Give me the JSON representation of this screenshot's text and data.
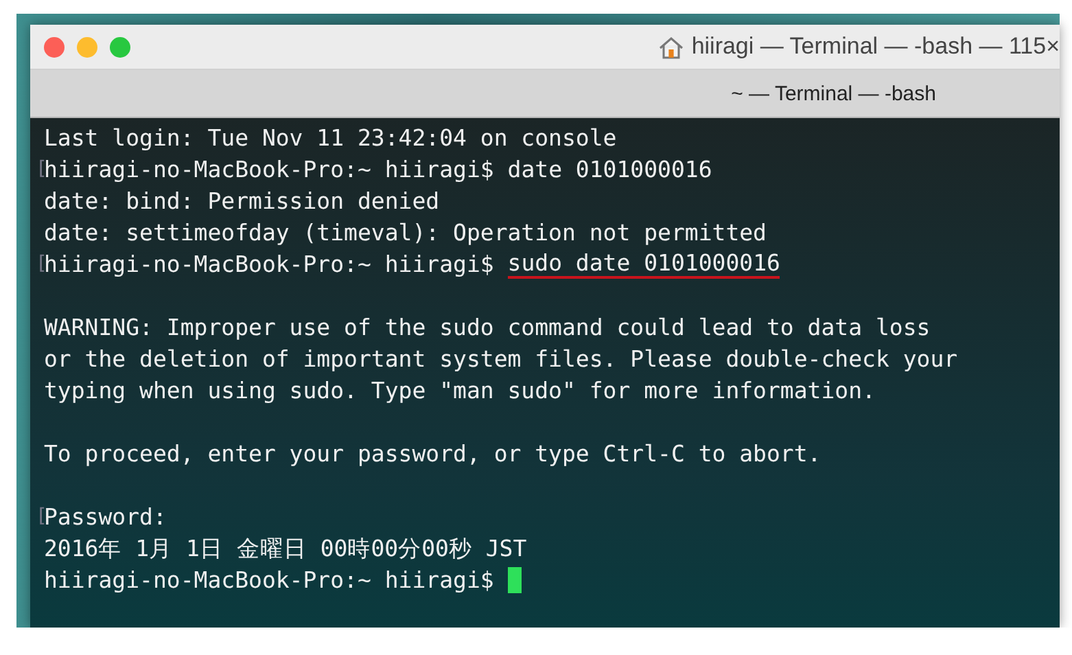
{
  "window": {
    "title": "hiiragi — Terminal — -bash — 115×",
    "tab": "~ — Terminal — -bash"
  },
  "lines": [
    {
      "kind": "output",
      "text": "Last login: Tue Nov 11 23:42:04 on console"
    },
    {
      "kind": "prompt",
      "marker": "[",
      "prompt": "hiiragi-no-MacBook-Pro:~ hiiragi$",
      "command": "date 0101000016",
      "underlined": false
    },
    {
      "kind": "output",
      "text": "date: bind: Permission denied"
    },
    {
      "kind": "output",
      "text": "date: settimeofday (timeval): Operation not permitted"
    },
    {
      "kind": "prompt",
      "marker": "[",
      "prompt": "hiiragi-no-MacBook-Pro:~ hiiragi$",
      "command": "sudo date 0101000016",
      "underlined": true
    },
    {
      "kind": "blank"
    },
    {
      "kind": "output",
      "text": "WARNING: Improper use of the sudo command could lead to data loss"
    },
    {
      "kind": "output",
      "text": "or the deletion of important system files. Please double-check your"
    },
    {
      "kind": "output",
      "text": "typing when using sudo. Type \"man sudo\" for more information."
    },
    {
      "kind": "blank"
    },
    {
      "kind": "output",
      "text": "To proceed, enter your password, or type Ctrl-C to abort."
    },
    {
      "kind": "blank"
    },
    {
      "kind": "output",
      "marker": "[",
      "text": "Password:"
    },
    {
      "kind": "output",
      "text": "2016年 1月 1日 金曜日 00時00分00秒 JST"
    },
    {
      "kind": "cursor",
      "prompt": "hiiragi-no-MacBook-Pro:~ hiiragi$"
    }
  ]
}
